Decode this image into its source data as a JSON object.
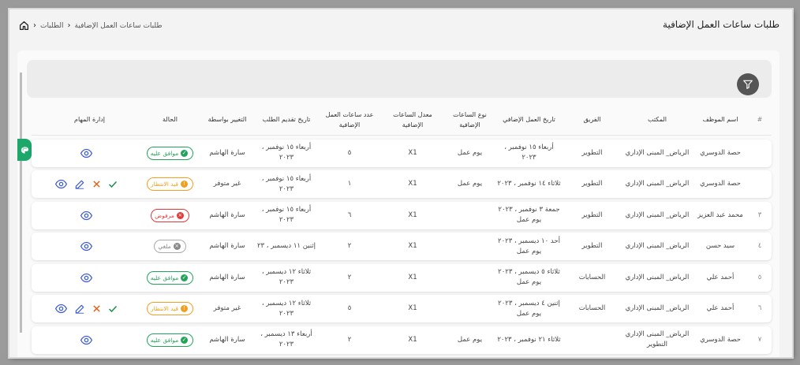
{
  "page": {
    "title": "طلبات ساعات العمل الإضافية",
    "breadcrumb": {
      "current": "طلبات ساعات العمل الإضافية",
      "parent": "الطلبات"
    }
  },
  "colors": {
    "approved": "#22a35a",
    "pending": "#f0a020",
    "rejected": "#e03a3a",
    "cancelled": "#888888",
    "accent_icon": "#3b5bdb",
    "side_tab": "#1ea76a"
  },
  "table": {
    "headers": {
      "num": "#",
      "name": "اسم الموظف",
      "office": "المكتب",
      "team": "الفريق",
      "date": "تاريخ العمل الإضافي",
      "type": "نوع الساعات الإضافية",
      "rate": "معدل الساعات الإضافية",
      "hours": "عدد ساعات العمل الإضافية",
      "submitted": "تاريخ تقديم الطلب",
      "changed_by": "التغيير بواسطة",
      "status": "الحالة",
      "actions": "إدارة المهام"
    },
    "rows": [
      {
        "num": "",
        "name": "حصة الدوسري",
        "office": "الرياض_ المبنى الإداري",
        "team": "التطوير",
        "date": "أربعاء ١٥ نوفمبر ، ٢٠٢٣",
        "type": "يوم عمل",
        "rate": "X1",
        "hours": "٥",
        "submitted": "أربعاء ١٥ نوفمبر ، ٢٠٢٣",
        "changed_by": "سارة الهاشم",
        "status": "موافق عليه"
      },
      {
        "num": "",
        "name": "حصة الدوسري",
        "office": "الرياض_ المبنى الإداري",
        "team": "التطوير",
        "date": "ثلاثاء ١٤ نوفمبر ، ٢٠٢٣",
        "type": "يوم عمل",
        "rate": "X1",
        "hours": "١",
        "submitted": "أربعاء ١٥ نوفمبر ، ٢٠٢٣",
        "changed_by": "غير متوفر",
        "status": "قيد الانتظار"
      },
      {
        "num": "٣",
        "name": "محمد عبد العزيز",
        "office": "الرياض_ المبنى الإداري",
        "team": "التطوير",
        "date": "جمعة ٣ نوفمبر ، ٢٠٢٣ يوم عمل",
        "type": "",
        "rate": "X1",
        "hours": "٦",
        "submitted": "أربعاء ١٥ نوفمبر ، ٢٠٢٣",
        "changed_by": "سارة الهاشم",
        "status": "مرفوض"
      },
      {
        "num": "٤",
        "name": "سيد حسن",
        "office": "الرياض_ المبنى الإداري",
        "team": "التطوير",
        "date": "أحد ١٠ ديسمبر ، ٢٠٢٣ يوم عمل",
        "type": "",
        "rate": "X1",
        "hours": "٢",
        "submitted": "إثنين ١١ ديسمبر ، ٢٣",
        "changed_by": "سارة الهاشم",
        "status": "ملغي"
      },
      {
        "num": "٥",
        "name": "أحمد علي",
        "office": "الرياض_ المبنى الإداري",
        "team": "الحسابات",
        "date": "ثلاثاء ٥ ديسمبر ، ٢٠٢٣ يوم عمل",
        "type": "",
        "rate": "X1",
        "hours": "٢",
        "submitted": "ثلاثاء ١٢ ديسمبر ، ٢٠٢٣",
        "changed_by": "سارة الهاشم",
        "status": "موافق عليه"
      },
      {
        "num": "٦",
        "name": "أحمد علي",
        "office": "الرياض_ المبنى الإداري",
        "team": "الحسابات",
        "date": "إثنين ٤ ديسمبر ، ٢٠٢٣ يوم عمل",
        "type": "",
        "rate": "X1",
        "hours": "٥",
        "submitted": "ثلاثاء ١٢ ديسمبر ، ٢٠٢٣",
        "changed_by": "غير متوفر",
        "status": "قيد الانتظار"
      },
      {
        "num": "٧",
        "name": "حصة الدوسري",
        "office": "الرياض_ المبنى الإداري التطوير",
        "team": "",
        "date": "ثلاثاء ٢١ نوفمبر ، ٢٠٢٣",
        "type": "يوم عمل",
        "rate": "X1",
        "hours": "٢",
        "submitted": "أربعاء ١٣ ديسمبر ، ٢٠٢٣",
        "changed_by": "سارة الهاشم",
        "status": "موافق عليه"
      }
    ]
  }
}
